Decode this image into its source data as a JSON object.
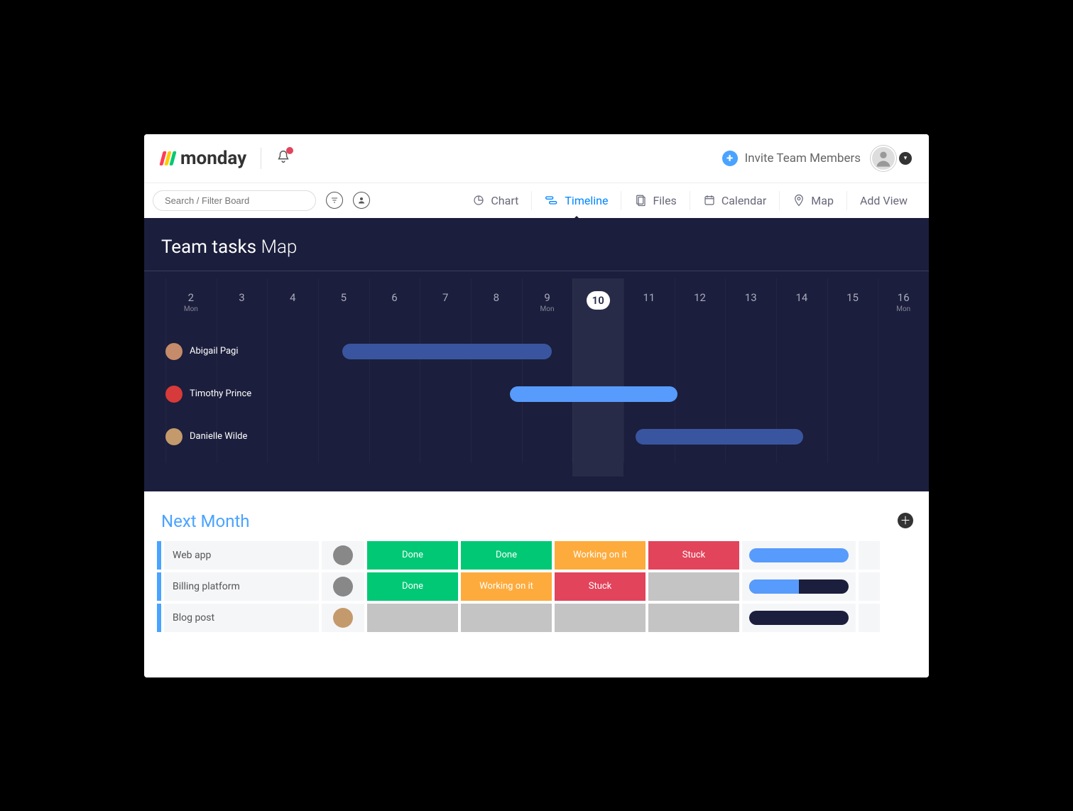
{
  "header": {
    "brand": "monday",
    "invite_label": "Invite Team Members"
  },
  "toolbar": {
    "search_placeholder": "Search / Filter Board",
    "views": {
      "chart": "Chart",
      "timeline": "Timeline",
      "files": "Files",
      "calendar": "Calendar",
      "map": "Map",
      "add": "Add View"
    }
  },
  "timeline": {
    "title_strong": "Team tasks",
    "title_light": "Map",
    "dates": [
      {
        "num": "2",
        "day": "Mon"
      },
      {
        "num": "3",
        "day": ""
      },
      {
        "num": "4",
        "day": ""
      },
      {
        "num": "5",
        "day": ""
      },
      {
        "num": "6",
        "day": ""
      },
      {
        "num": "7",
        "day": ""
      },
      {
        "num": "8",
        "day": ""
      },
      {
        "num": "9",
        "day": "Mon"
      },
      {
        "num": "10",
        "day": "",
        "today": true
      },
      {
        "num": "11",
        "day": ""
      },
      {
        "num": "12",
        "day": ""
      },
      {
        "num": "13",
        "day": ""
      },
      {
        "num": "14",
        "day": ""
      },
      {
        "num": "15",
        "day": ""
      },
      {
        "num": "16",
        "day": "Mon"
      }
    ],
    "rows": [
      {
        "name": "Abigail  Pagi",
        "avatar_color": "#c58b6a",
        "bar_start": 1,
        "bar_span": 5,
        "bar_color": "#3a559f"
      },
      {
        "name": "Timothy Prince",
        "avatar_color": "#d73a3a",
        "bar_start": 5,
        "bar_span": 4,
        "bar_color": "#579bfc"
      },
      {
        "name": "Danielle Wilde",
        "avatar_color": "#c49a6c",
        "bar_start": 8,
        "bar_span": 4,
        "bar_color": "#3a559f"
      }
    ]
  },
  "board": {
    "group_title": "Next Month",
    "rows": [
      {
        "name": "Web app",
        "owner_color": "#888",
        "statuses": [
          "Done",
          "Done",
          "Working on it",
          "Stuck"
        ],
        "status_classes": [
          "done",
          "done",
          "working",
          "stuck"
        ],
        "progress": 100
      },
      {
        "name": "Billing platform",
        "owner_color": "#888",
        "statuses": [
          "Done",
          "Working on it",
          "Stuck",
          ""
        ],
        "status_classes": [
          "done",
          "working",
          "stuck",
          "empty"
        ],
        "progress": 50
      },
      {
        "name": "Blog post",
        "owner_color": "#c49a6c",
        "statuses": [
          "",
          "",
          "",
          ""
        ],
        "status_classes": [
          "empty",
          "empty",
          "empty",
          "empty"
        ],
        "progress": 0
      }
    ]
  }
}
